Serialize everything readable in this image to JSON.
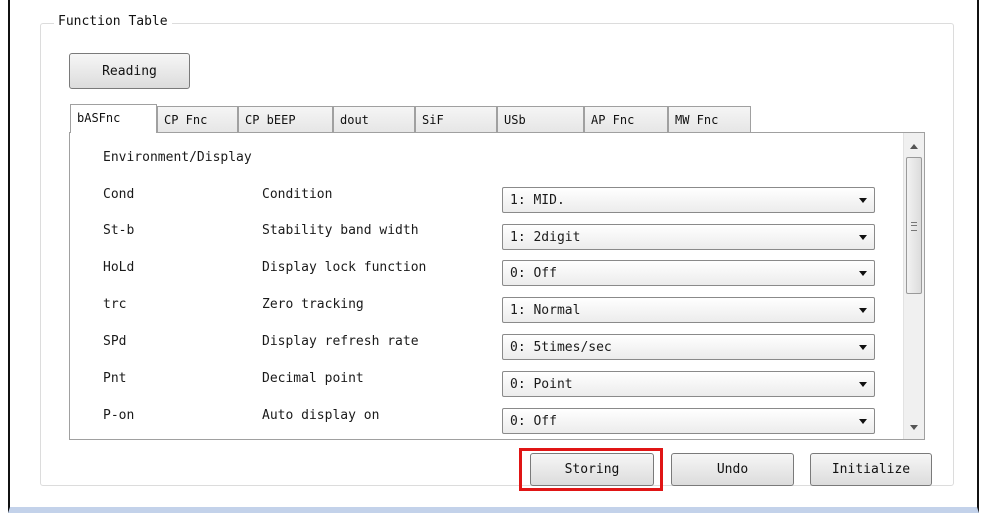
{
  "group_title": "Function Table",
  "reading_button": "Reading",
  "tabs": [
    {
      "label": "bASFnc",
      "active": true
    },
    {
      "label": "CP Fnc",
      "active": false
    },
    {
      "label": "CP bEEP",
      "active": false
    },
    {
      "label": "dout",
      "active": false
    },
    {
      "label": "SiF",
      "active": false
    },
    {
      "label": "USb",
      "active": false
    },
    {
      "label": "AP Fnc",
      "active": false
    },
    {
      "label": "MW Fnc",
      "active": false
    }
  ],
  "section_title": "Environment/Display",
  "rows": [
    {
      "code": "Cond",
      "description": "Condition",
      "value": "1: MID."
    },
    {
      "code": "St-b",
      "description": "Stability band width",
      "value": "1: 2digit"
    },
    {
      "code": "HoLd",
      "description": "Display lock function",
      "value": "0: Off"
    },
    {
      "code": "trc",
      "description": "Zero tracking",
      "value": "1: Normal"
    },
    {
      "code": "SPd",
      "description": "Display refresh rate",
      "value": "0: 5times/sec"
    },
    {
      "code": "Pnt",
      "description": "Decimal point",
      "value": "0: Point"
    },
    {
      "code": "P-on",
      "description": "Auto display on",
      "value": "0: Off"
    }
  ],
  "buttons": {
    "storing": "Storing",
    "undo": "Undo",
    "initialize": "Initialize"
  },
  "colors": {
    "highlight": "#e01515",
    "window_border_bottom": "#c3d2ea"
  }
}
